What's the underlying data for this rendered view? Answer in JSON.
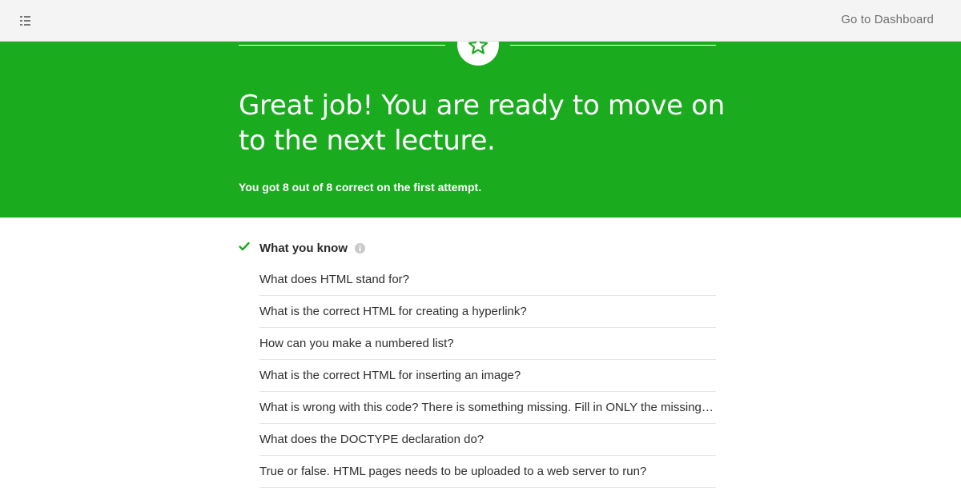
{
  "header": {
    "menu_icon": "list-icon",
    "dashboard_link": "Go to Dashboard"
  },
  "banner": {
    "badge_icon": "star-icon",
    "headline": "Great job! You are ready to move on to the next lecture.",
    "score_text": "You got 8 out of 8 correct on the first attempt.",
    "color": "#1aab1f"
  },
  "section": {
    "status_icon": "checkmark-icon",
    "title": "What you know",
    "info_icon": "info-icon",
    "questions": [
      "What does HTML stand for?",
      "What is the correct HTML for creating a hyperlink?",
      "How can you make a numbered list?",
      "What is the correct HTML for inserting an image?",
      "What is wrong with this code? There is something missing. Fill in ONLY the missing code.",
      "What does the DOCTYPE declaration do?",
      "True or false. HTML pages needs to be uploaded to a web server to run?"
    ]
  }
}
